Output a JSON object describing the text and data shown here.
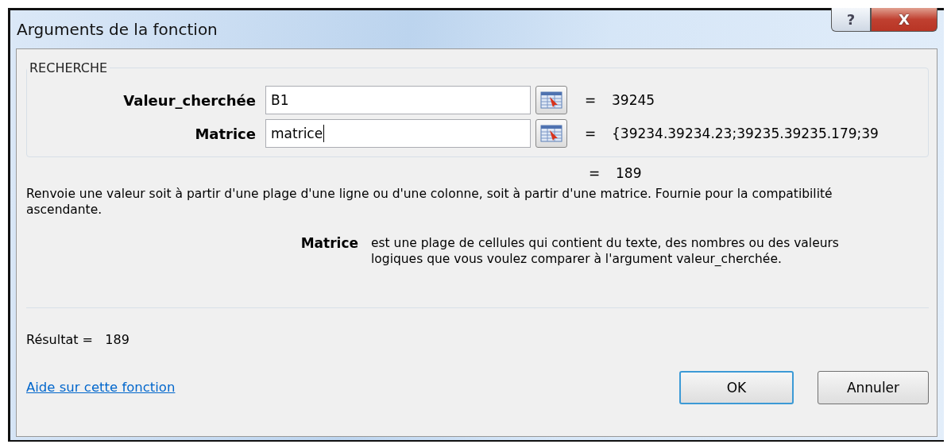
{
  "window": {
    "title": "Arguments de la fonction",
    "controls": [
      {
        "kind": "help",
        "label": "?"
      },
      {
        "kind": "close",
        "label": "X"
      }
    ]
  },
  "group": {
    "title": "RECHERCHE",
    "arguments": [
      {
        "label": "Valeur_cherchée",
        "value": "B1",
        "equals": "=",
        "result": "39245",
        "focused": false
      },
      {
        "label": "Matrice",
        "value": "matrice",
        "equals": "=",
        "result": "{39234.39234.23;39235.39235.179;39",
        "focused": true
      }
    ]
  },
  "formula_result": {
    "equals": "=",
    "value": "189"
  },
  "description": "Renvoie une valeur soit à partir d'une plage d'une ligne ou d'une colonne, soit à partir d'une matrice. Fournie pour la compatibilité ascendante.",
  "argument_help": {
    "name": "Matrice",
    "text": "est une plage de cellules qui contient du texte, des nombres ou des valeurs logiques que vous voulez comparer à l'argument valeur_cherchée."
  },
  "result": {
    "label": "Résultat =",
    "value": "189"
  },
  "help_link": "Aide sur cette fonction",
  "buttons": [
    {
      "label": "OK",
      "default": true
    },
    {
      "label": "Annuler",
      "default": false
    }
  ]
}
